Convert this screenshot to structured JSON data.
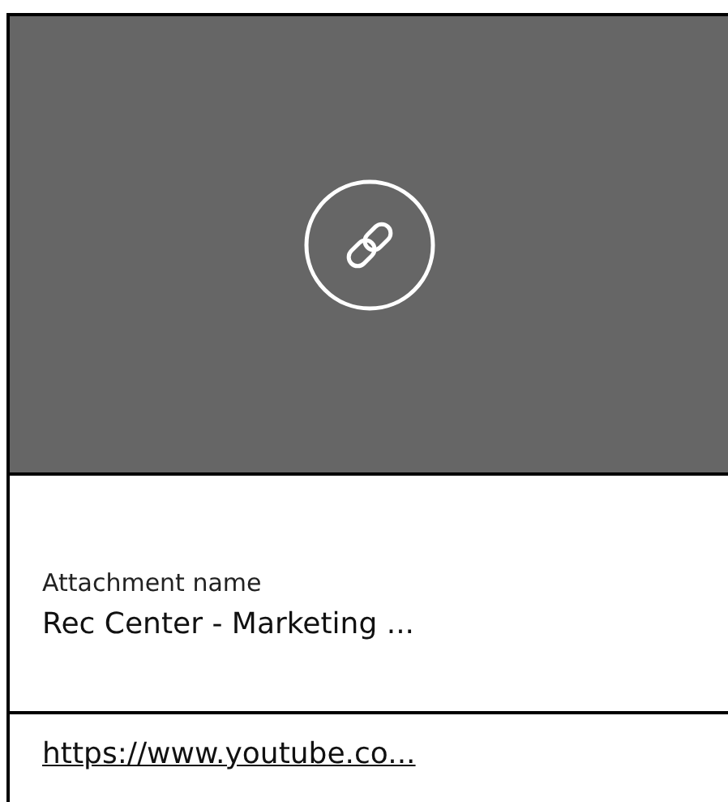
{
  "attachment": {
    "label": "Attachment name",
    "name": "Rec Center - Marketing ...",
    "link": "https://www.youtube.co..."
  }
}
